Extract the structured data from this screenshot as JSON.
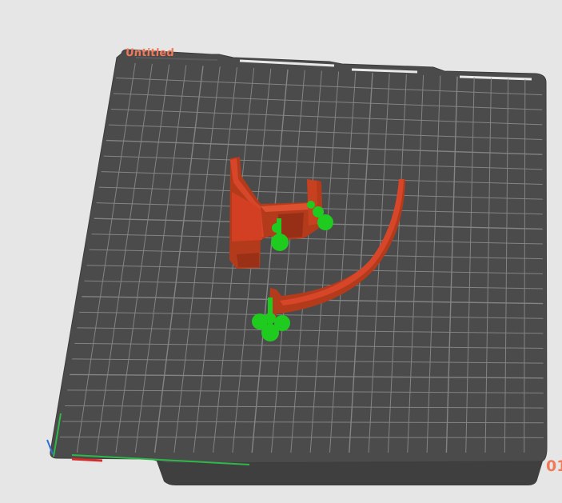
{
  "plate": {
    "name": "Untitled",
    "corner_number": "01"
  },
  "colors": {
    "background": "#e6e6e6",
    "plate": "#4b4b4b",
    "grid": "#8e8e8e",
    "model_side": "#b33b1c",
    "model_top": "#d8462a",
    "support": "#1ecb1e",
    "axis_x": "#d42a2a",
    "axis_y": "#2fb84a",
    "axis_z": "#2f6fd6",
    "label": "#f0795a"
  },
  "icons": [
    "plate-tab-icon",
    "axis-gizmo-icon"
  ]
}
